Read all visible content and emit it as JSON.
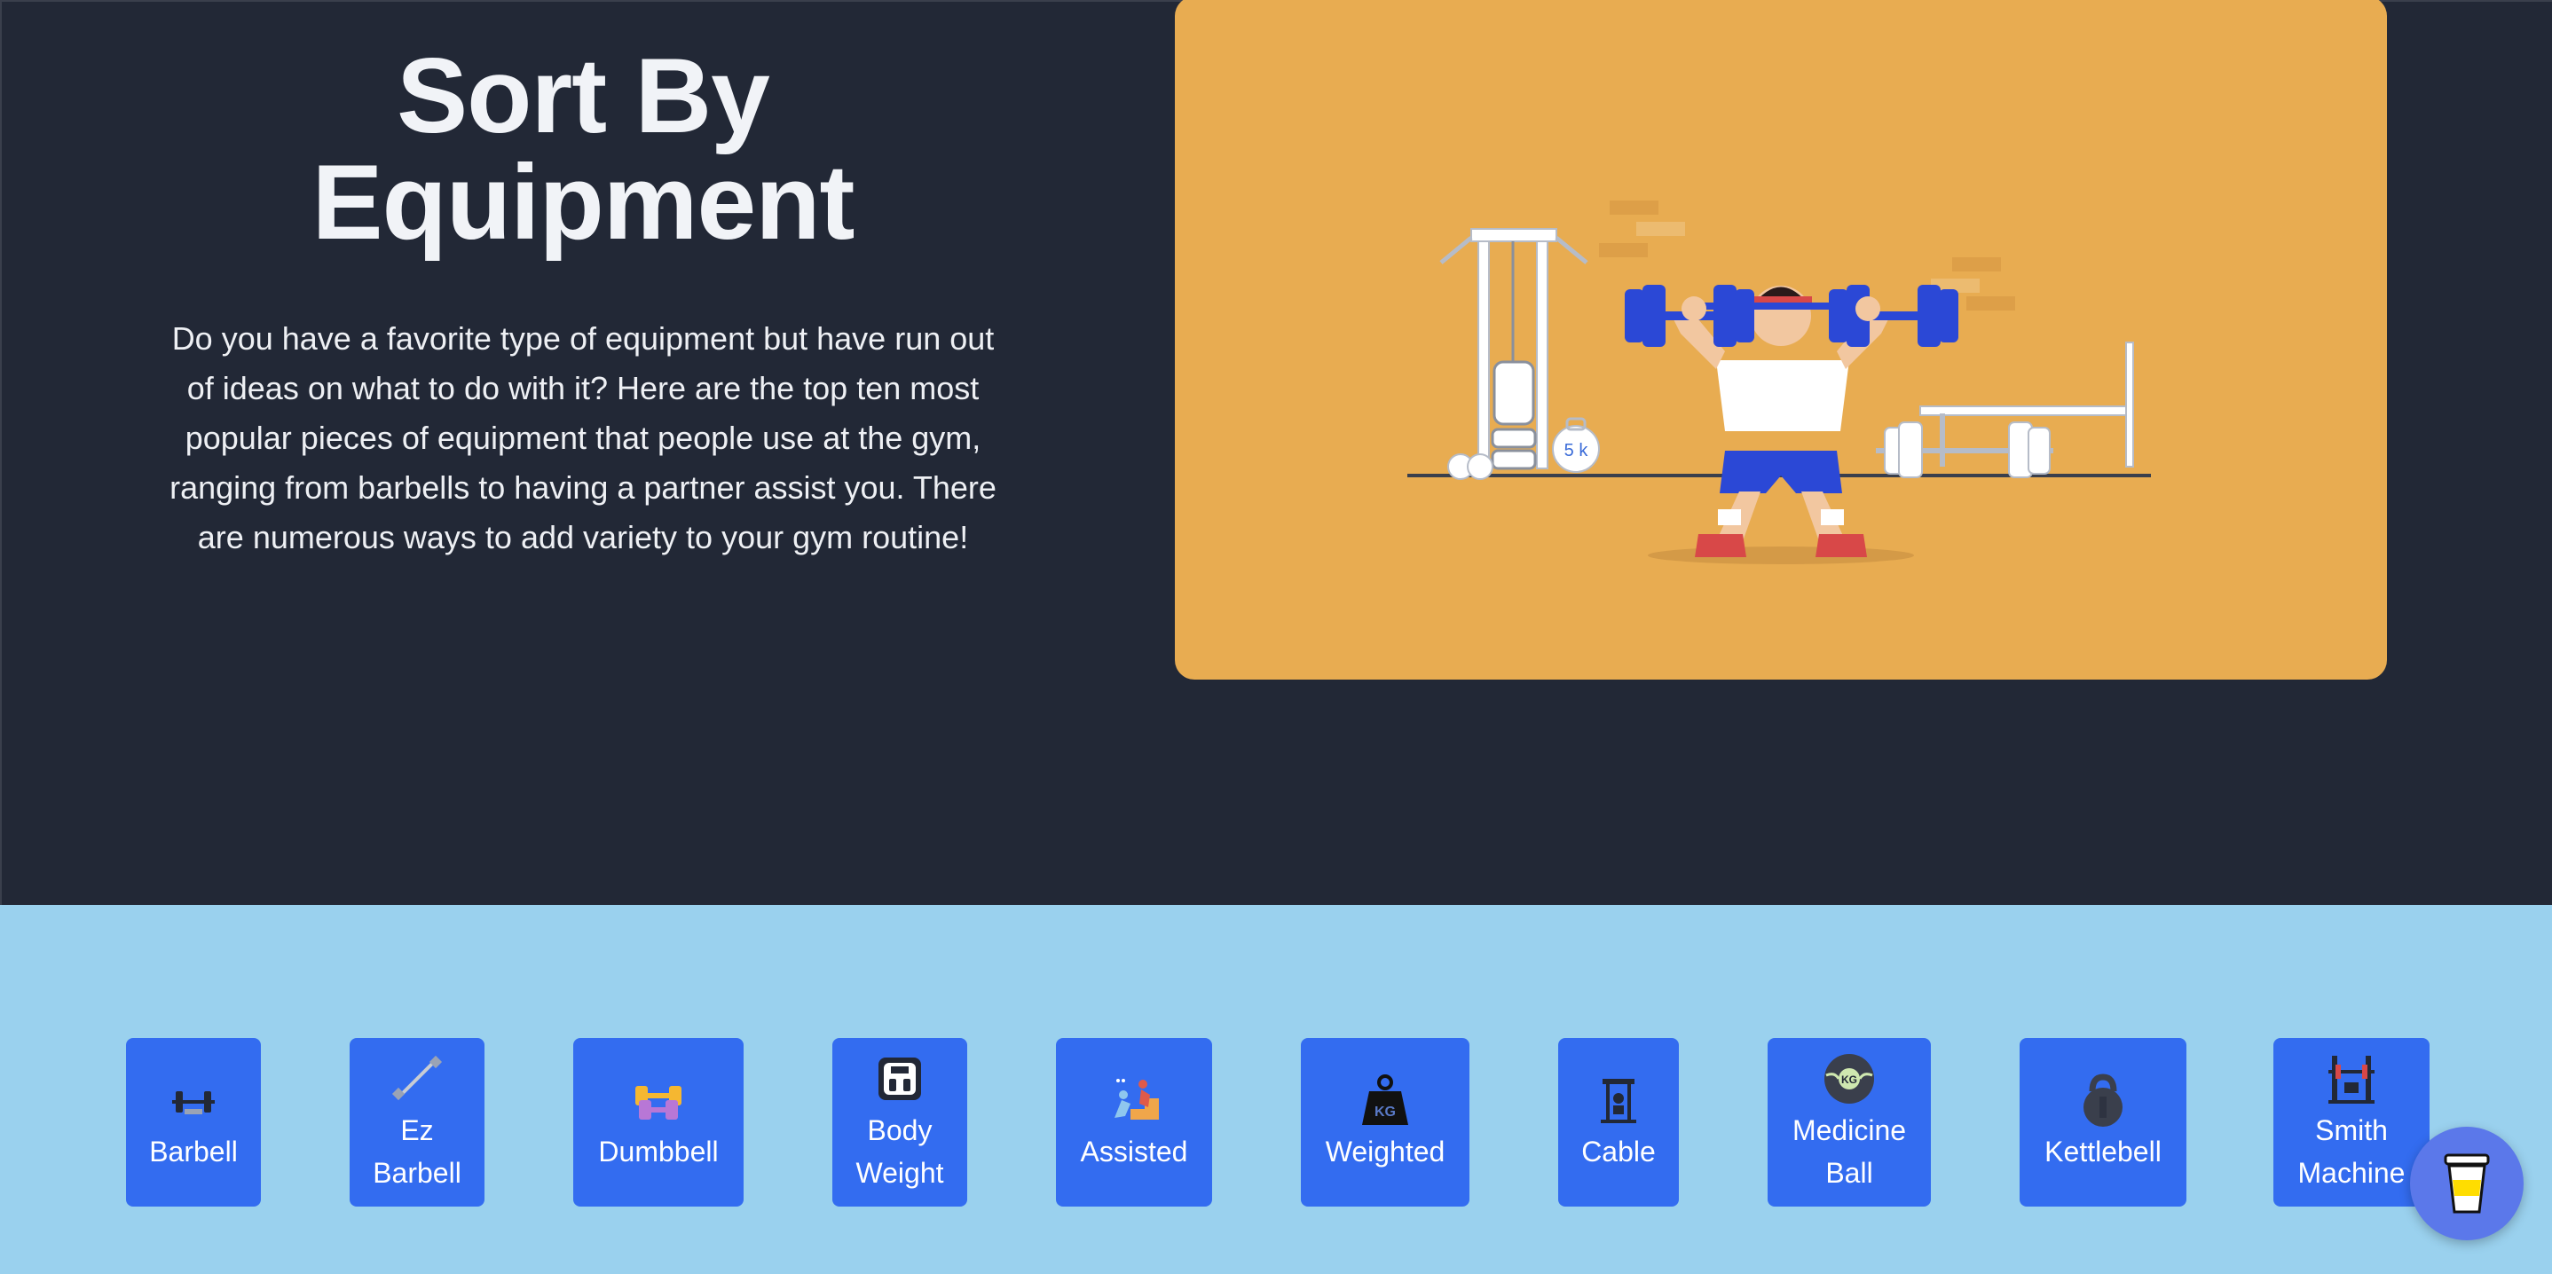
{
  "hero": {
    "title_line1": "Sort By",
    "title_line2": "Equipment",
    "description": "Do you have a favorite type of equipment but have run out of ideas on what to do with it? Here are the top ten most popular pieces of equipment that people use at the gym, ranging from barbells to having a partner assist you. There are numerous ways to add variety to your gym routine!"
  },
  "illustration": {
    "kettlebell_label": "5 k",
    "bg_color": "#e8ac51"
  },
  "equipment": {
    "barbell": "Barbell",
    "ez_barbell_l1": "Ez",
    "ez_barbell_l2": "Barbell",
    "dumbbell": "Dumbbell",
    "body_weight_l1": "Body",
    "body_weight_l2": "Weight",
    "assisted": "Assisted",
    "weighted": "Weighted",
    "cable": "Cable",
    "medicine_ball_l1": "Medicine",
    "medicine_ball_l2": "Ball",
    "kettlebell": "Kettlebell",
    "smith_machine_l1": "Smith",
    "smith_machine_l2": "Machine"
  },
  "icons": {
    "weighted_label": "KG",
    "medicine_ball_label": "KG",
    "coffee": "coffee-cup-icon"
  },
  "colors": {
    "hero_bg": "#222836",
    "band_bg": "#9ad1ee",
    "card_bg": "#336cf0",
    "coffee_button": "#5b78ea"
  }
}
